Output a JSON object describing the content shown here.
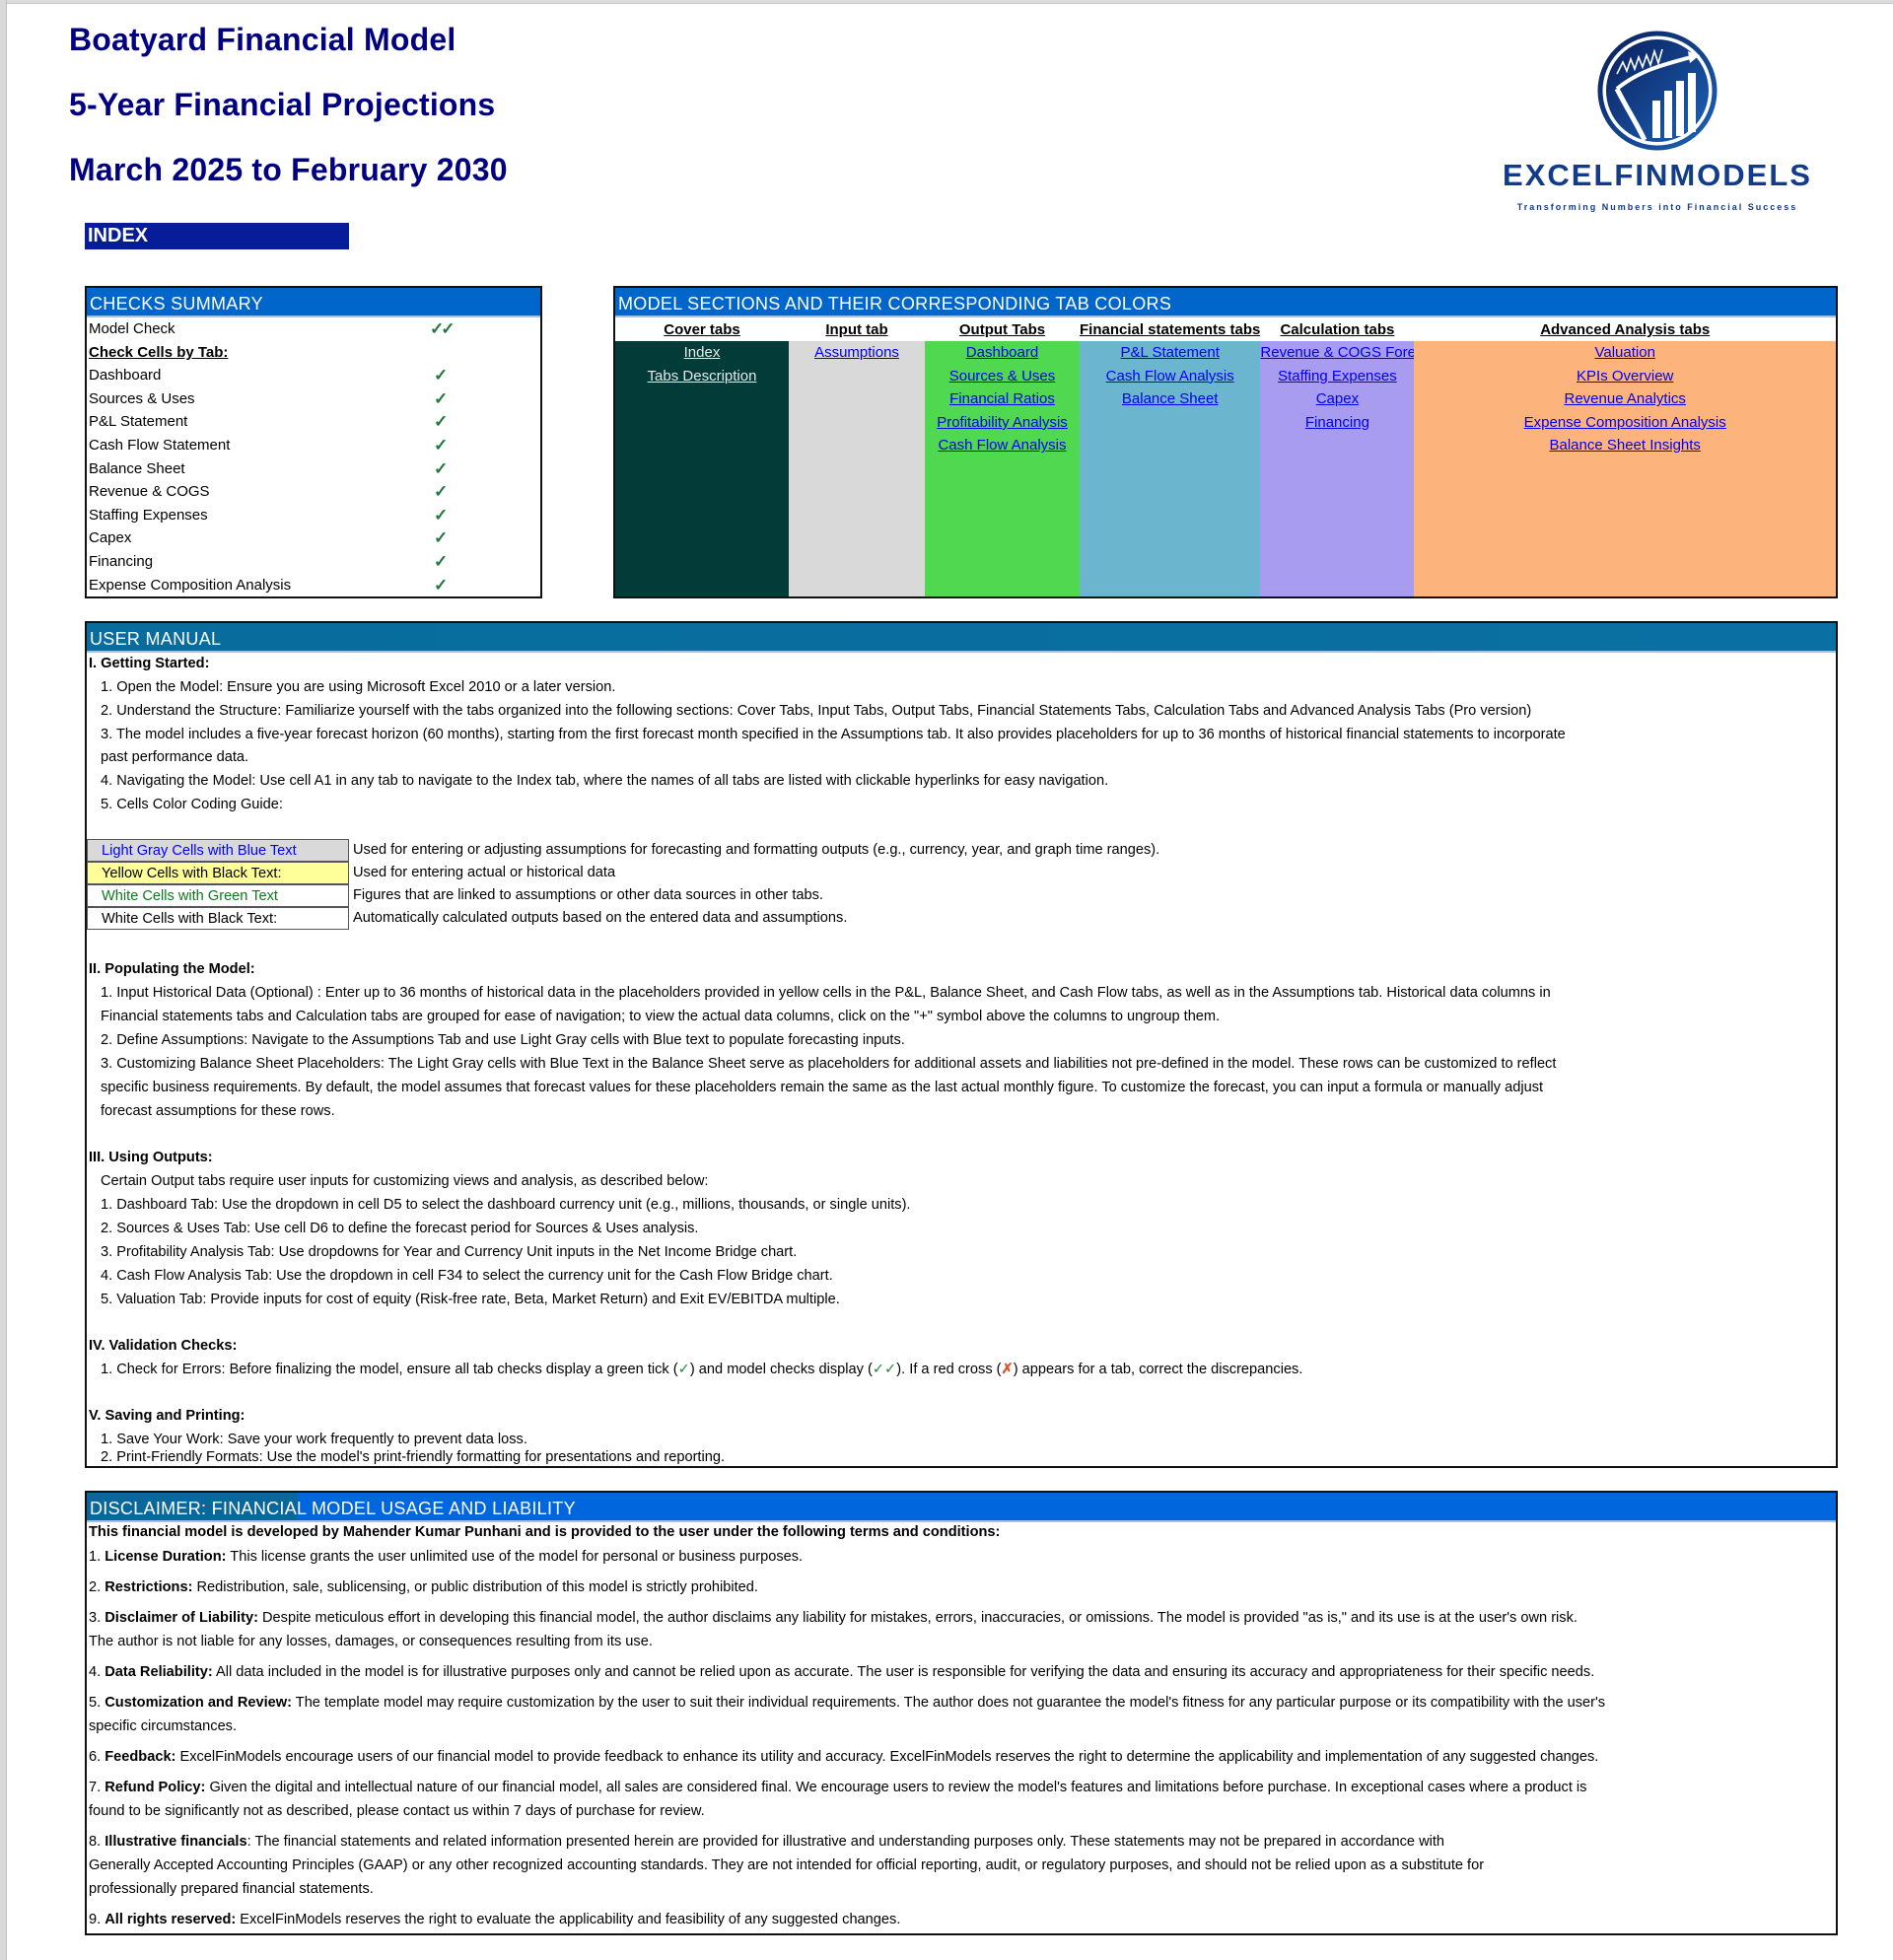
{
  "header": {
    "title": "Boatyard Financial Model",
    "subtitle": "5-Year Financial Projections",
    "period": "March 2025 to February 2030",
    "index_label": "INDEX"
  },
  "logo": {
    "name": "EXCELFINMODELS",
    "tagline": "Transforming Numbers into Financial Success",
    "colors": {
      "primary": "#123c8a",
      "dark": "#0a1f5c"
    }
  },
  "checks": {
    "title": "CHECKS  SUMMARY",
    "model_check_label": "Model Check",
    "model_check_mark": "✓✓",
    "by_tab_label": "Check Cells by Tab:",
    "tick": "✓",
    "items": [
      "Dashboard",
      "Sources & Uses",
      "P&L Statement",
      "Cash Flow Statement",
      "Balance Sheet",
      "Revenue & COGS",
      "Staffing Expenses",
      "Capex",
      "Financing",
      "Expense Composition Analysis"
    ]
  },
  "sections": {
    "title": "MODEL SECTIONS AND THEIR CORRESPONDING TAB COLORS",
    "columns": [
      {
        "heading": "Cover tabs",
        "color": "#033b38",
        "links": [
          "Index",
          "Tabs Description"
        ]
      },
      {
        "heading": "Input tab",
        "color": "#d9d9d9",
        "links": [
          "Assumptions "
        ]
      },
      {
        "heading": "Output Tabs",
        "color": "#50d850",
        "links": [
          "Dashboard",
          "Sources & Uses",
          "Financial Ratios ",
          "Profitability Analysis",
          "Cash Flow Analysis"
        ]
      },
      {
        "heading": "Financial statements tabs",
        "color": "#6bb6ce",
        "links": [
          "P&L Statement",
          "Cash Flow Analysis",
          "Balance Sheet"
        ]
      },
      {
        "heading": "Calculation tabs",
        "color": "#a79cf0",
        "links": [
          "Revenue & COGS Forecast",
          "Staffing Expenses",
          "Capex ",
          "Financing"
        ]
      },
      {
        "heading": "Advanced Analysis tabs",
        "color": "#fdb47c",
        "links": [
          "Valuation",
          "KPIs Overview",
          "Revenue Analytics",
          "Expense Composition Analysis",
          "Balance Sheet Insights"
        ]
      }
    ]
  },
  "manual": {
    "title": "USER MANUAL",
    "s1_head": "I. Getting Started:",
    "s1": [
      "1. Open the Model: Ensure you are using Microsoft Excel 2010 or a later version.",
      "2. Understand the Structure: Familiarize yourself with the tabs organized into the following sections: Cover Tabs, Input Tabs, Output Tabs, Financial Statements Tabs,  Calculation Tabs and Advanced Analysis Tabs (Pro version)",
      "3. The model includes a five-year forecast horizon (60 months), starting from the first forecast month specified in the Assumptions tab. It also provides placeholders for up to 36 months of historical financial statements to incorporate",
      "past performance data.",
      "4. Navigating the Model: Use cell A1 in any tab to navigate to the Index tab, where the names of all tabs are listed with clickable hyperlinks for easy navigation.",
      "5. Cells Color Coding Guide:"
    ],
    "legend": [
      {
        "label": "Light Gray Cells with Blue Text",
        "desc": "Used for entering or adjusting assumptions for forecasting and formatting outputs (e.g., currency, year, and graph time ranges)."
      },
      {
        "label": "Yellow Cells with Black Text:",
        "desc": "Used for entering actual or historical data"
      },
      {
        "label": "White Cells with Green Text",
        "desc": "Figures that are linked to assumptions or other data sources in other tabs."
      },
      {
        "label": "White Cells with Black Text:",
        "desc": "Automatically calculated outputs based on the entered data and assumptions."
      }
    ],
    "s2_head": "II. Populating the Model:",
    "s2": [
      "1. Input Historical Data (Optional) : Enter up to 36 months of historical data in the placeholders provided in yellow cells in the P&L, Balance Sheet, and Cash Flow tabs, as well as in the Assumptions tab. Historical data columns in",
      "Financial statements tabs and Calculation tabs are grouped for ease of navigation; to view the actual data columns, click on the \"+\" symbol above the columns to ungroup them.",
      "2. Define Assumptions: Navigate to the Assumptions Tab and use Light Gray cells with Blue text to populate forecasting inputs.",
      "3. Customizing Balance Sheet Placeholders: The Light Gray cells with Blue Text in the Balance Sheet serve as placeholders for additional assets and liabilities not pre-defined in the model. These rows can be customized to reflect",
      "specific business requirements. By default, the model assumes that forecast values for these placeholders remain the same as the last actual monthly figure. To customize the forecast, you can input a formula or manually adjust",
      "forecast assumptions for these rows."
    ],
    "s3_head": "III. Using Outputs:",
    "s3": [
      "Certain Output tabs require user inputs for customizing views and analysis, as described below:",
      "1. Dashboard Tab: Use the dropdown in cell D5 to select the dashboard currency unit (e.g., millions, thousands, or single units).",
      "2. Sources & Uses Tab: Use cell D6 to define the forecast period for Sources & Uses analysis.",
      "3. Profitability Analysis Tab: Use dropdowns for Year and Currency Unit inputs in the Net Income Bridge chart.",
      "4. Cash Flow Analysis Tab: Use the dropdown in cell F34 to select the currency unit for the Cash Flow Bridge chart.",
      "5. Valuation Tab: Provide inputs for cost of equity (Risk-free rate, Beta, Market Return) and Exit EV/EBITDA multiple."
    ],
    "s4_head": "IV. Validation Checks:",
    "s4": {
      "part1": "1. Check for Errors:  Before finalizing the model, ensure all tab checks display a green tick (",
      "tick": "✓",
      "part2": ") and model checks display  (",
      "ticks": "✓✓",
      "part3": "). If a red cross (",
      "cross": "✗",
      "part4": ") appears for a tab, correct the discrepancies."
    },
    "s5_head": "V. Saving and Printing:",
    "s5": [
      "1. Save Your Work: Save your work frequently to prevent data loss.",
      "2. Print-Friendly Formats: Use the model's print-friendly formatting for presentations and reporting."
    ]
  },
  "disclaimer": {
    "title": "DISCLAIMER: FINANCIAL MODEL USAGE AND LIABILITY",
    "intro": "This financial model  is developed by Mahender Kumar Punhani and is provided to the user under the following terms and conditions:",
    "items": [
      {
        "num": "1. ",
        "term": "License Duration:",
        "lines": [
          " This license grants the user unlimited use of the model for personal or business purposes."
        ]
      },
      {
        "num": "2. ",
        "term": "Restrictions:",
        "lines": [
          " Redistribution, sale, sublicensing, or public distribution of this model is strictly prohibited."
        ]
      },
      {
        "num": "3. ",
        "term": "Disclaimer of Liability:",
        "lines": [
          " Despite meticulous effort in developing this financial model, the author disclaims any liability for mistakes, errors, inaccuracies, or omissions. The model is provided \"as is,\" and its use is at the user's own risk.",
          "The author is not liable for  any losses, damages, or consequences resulting from its use."
        ]
      },
      {
        "num": "4. ",
        "term": "Data Reliability:",
        "lines": [
          " All data included in the model is for illustrative purposes only and cannot be relied upon as accurate. The user is  responsible for verifying the data and ensuring its accuracy and appropriateness for their specific needs."
        ]
      },
      {
        "num": "5. ",
        "term": "Customization and Review:",
        "lines": [
          " The template model may require customization by the user to suit their individual requirements. The author does not guarantee the model's fitness for any  particular purpose or its compatibility with the user's",
          "specific circumstances."
        ]
      },
      {
        "num": "6. ",
        "term": "Feedback:",
        "lines": [
          " ExcelFinModels encourage users of our financial model to provide feedback to enhance its utility and accuracy. ExcelFinModels reserves the right to determine the applicability and implementation of any suggested changes."
        ]
      },
      {
        "num": "7. ",
        "term": "Refund Policy:",
        "lines": [
          " Given the digital and intellectual nature of our financial model, all sales are considered final. We encourage users to review the model's features and limitations before purchase. In exceptional cases where a product is",
          "found to be  significantly not as described, please contact us within 7 days of purchase for review."
        ]
      },
      {
        "num": "8. ",
        "term": "Illustrative financials",
        "lines": [
          ": The financial statements and related information presented herein are provided for illustrative and understanding purposes only. These statements may not be prepared in accordance with",
          "Generally Accepted Accounting Principles (GAAP)  or any other  recognized accounting standards. They are not intended for official reporting, audit, or regulatory purposes, and should not be relied upon as a substitute for",
          "professionally prepared financial statements."
        ]
      },
      {
        "num": "9. ",
        "term": "All rights reserved:",
        "lines": [
          " ExcelFinModels reserves the right to evaluate the applicability and feasibility of any suggested changes."
        ]
      }
    ]
  }
}
